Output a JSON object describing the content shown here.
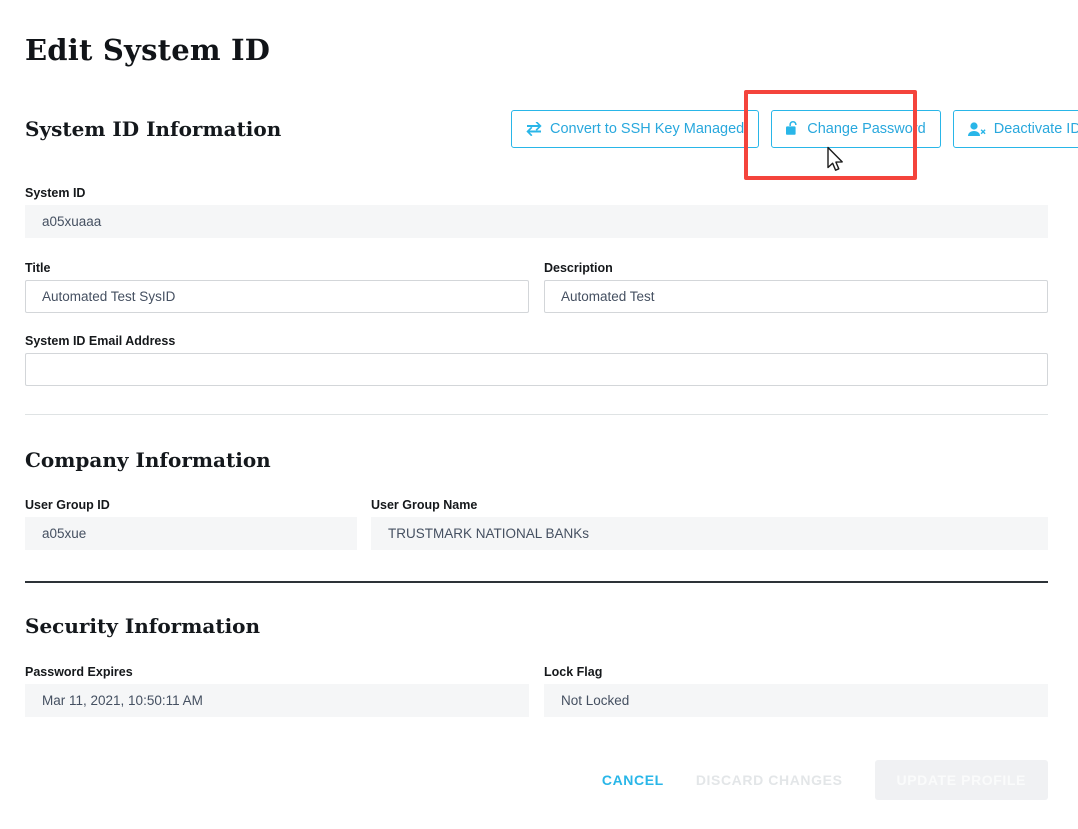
{
  "page": {
    "title": "Edit System ID"
  },
  "sections": {
    "system_id": {
      "heading": "System ID Information",
      "actions": [
        {
          "label": "Convert to SSH Key Managed",
          "icon": "exchange-arrows-icon"
        },
        {
          "label": "Change Password",
          "icon": "unlocked-padlock-icon"
        },
        {
          "label": "Deactivate ID",
          "icon": "user-remove-icon"
        }
      ],
      "fields": {
        "system_id": {
          "label": "System ID",
          "value": "a05xuaaa",
          "readonly": true
        },
        "title": {
          "label": "Title",
          "value": "Automated Test SysID",
          "readonly": false
        },
        "description": {
          "label": "Description",
          "value": "Automated Test",
          "readonly": false
        },
        "email": {
          "label": "System ID Email Address",
          "value": "",
          "readonly": false
        }
      }
    },
    "company": {
      "heading": "Company Information",
      "fields": {
        "user_group_id": {
          "label": "User Group ID",
          "value": "a05xue",
          "readonly": true
        },
        "user_group_name": {
          "label": "User Group Name",
          "value": "TRUSTMARK NATIONAL BANKs",
          "readonly": true
        }
      }
    },
    "security": {
      "heading": "Security Information",
      "fields": {
        "password_expires": {
          "label": "Password Expires",
          "value": "Mar 11, 2021, 10:50:11 AM",
          "readonly": true
        },
        "lock_flag": {
          "label": "Lock Flag",
          "value": "Not Locked",
          "readonly": true
        }
      }
    }
  },
  "footer": {
    "cancel_label": "CANCEL",
    "discard_label": "DISCARD CHANGES",
    "update_label": "UPDATE PROFILE"
  },
  "annotation": {
    "type": "highlight-rectangle",
    "target": "Change Password",
    "color": "#f4443c"
  },
  "colors": {
    "accent": "#29b6e8",
    "heading": "#14181c",
    "readonly_bg": "#f5f6f7",
    "input_border": "#d3d6d9",
    "value_text": "#455061",
    "disabled_text": "#e3e6e8",
    "disabled_button_bg": "#f0f1f3",
    "highlight": "#f4443c"
  }
}
